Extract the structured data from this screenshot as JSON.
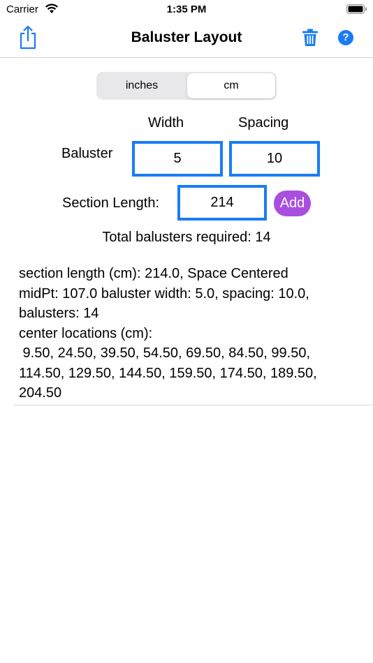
{
  "status_bar": {
    "carrier": "Carrier",
    "time": "1:35 PM"
  },
  "nav": {
    "title": "Baluster Layout"
  },
  "units": {
    "inches_label": "inches",
    "cm_label": "cm",
    "selected": "cm"
  },
  "form": {
    "width_header": "Width",
    "spacing_header": "Spacing",
    "baluster_label": "Baluster",
    "width_value": "5",
    "spacing_value": "10",
    "section_length_label": "Section Length:",
    "section_length_value": "214",
    "add_label": "Add"
  },
  "result": {
    "total": "Total balusters required: 14"
  },
  "details": {
    "lines": [
      "section length (cm): 214.0, Space Centered",
      "midPt: 107.0 baluster width: 5.0, spacing: 10.0,",
      "balusters: 14",
      "center locations (cm):",
      " 9.50, 24.50, 39.50, 54.50, 69.50, 84.50, 99.50,",
      "114.50, 129.50, 144.50, 159.50, 174.50, 189.50,",
      "204.50"
    ]
  },
  "colors": {
    "accent": "#1a7cf5",
    "add_button": "#a94fe0"
  },
  "icons": {
    "share": "share-icon",
    "trash": "trash-icon",
    "help": "help-icon",
    "wifi": "wifi-icon",
    "battery": "battery-icon"
  }
}
